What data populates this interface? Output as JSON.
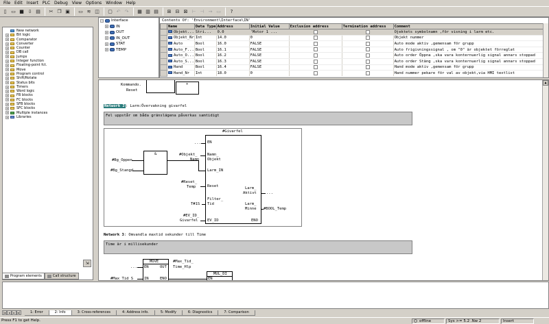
{
  "menu": [
    "File",
    "Edit",
    "Insert",
    "PLC",
    "Debug",
    "View",
    "Options",
    "Window",
    "Help"
  ],
  "catalog": {
    "items": [
      {
        "label": "New network",
        "expand": false,
        "kind": "new"
      },
      {
        "label": "Bit logic",
        "expand": true
      },
      {
        "label": "Comparator",
        "expand": true
      },
      {
        "label": "Converter",
        "expand": true
      },
      {
        "label": "Counter",
        "expand": true
      },
      {
        "label": "DB call",
        "expand": true
      },
      {
        "label": "Jumps",
        "expand": true
      },
      {
        "label": "Integer function",
        "expand": true
      },
      {
        "label": "Floating-point fct.",
        "expand": true
      },
      {
        "label": "Move",
        "expand": true
      },
      {
        "label": "Program control",
        "expand": true
      },
      {
        "label": "Shift/Rotate",
        "expand": true
      },
      {
        "label": "Status bits",
        "expand": true
      },
      {
        "label": "Timers",
        "expand": true
      },
      {
        "label": "Word logic",
        "expand": true
      },
      {
        "label": "FB blocks",
        "expand": true
      },
      {
        "label": "FC blocks",
        "expand": true
      },
      {
        "label": "SFB blocks",
        "expand": true
      },
      {
        "label": "SFC blocks",
        "expand": true
      },
      {
        "label": "Multiple instances",
        "expand": true,
        "kind": "multi"
      },
      {
        "label": "Libraries",
        "expand": true,
        "kind": "lib"
      }
    ],
    "tabs": [
      "Program elements",
      "Call structure"
    ]
  },
  "interface": {
    "root": "Interface",
    "items": [
      "IN",
      "OUT",
      "IN_OUT",
      "STAT",
      "TEMP"
    ]
  },
  "vartable": {
    "title": "Contents Of: 'Environment\\Interface\\IN'",
    "headers": [
      "Name",
      "Data Type",
      "Address",
      "Initial Value",
      "Exclusion address",
      "Termination address",
      "Comment"
    ],
    "rows": [
      {
        "name": "Objekt...",
        "type": "Stri...",
        "addr": "0.0",
        "init": "'Motor 1  ...",
        "comment": "Ojektets symbolnamn ,för visning i larm etc.",
        "sel": true
      },
      {
        "name": "Objekt_Nr",
        "type": "Int",
        "addr": "14.0",
        "init": "0",
        "comment": "Objekt nummer"
      },
      {
        "name": "Auto",
        "type": "Bool",
        "addr": "16.0",
        "init": "FALSE",
        "comment": "Auto mode aktiv ,gemensam för grupp"
      },
      {
        "name": "Auto_F...",
        "type": "Bool",
        "addr": "16.1",
        "init": "FALSE",
        "comment": "Auto frigivningssignal , om \"0\" är objektet förreglat"
      },
      {
        "name": "Auto_O...",
        "type": "Bool",
        "addr": "16.2",
        "init": "FALSE",
        "comment": "Auto order Öppna ,ska vara konternuerlig signal annars stoppad"
      },
      {
        "name": "Auto_S...",
        "type": "Bool",
        "addr": "16.3",
        "init": "FALSE",
        "comment": "Auto order Stäng ,ska vara konternuerlig signal annars stoppad"
      },
      {
        "name": "Hand",
        "type": "Bool",
        "addr": "16.4",
        "init": "FALSE",
        "comment": "Hand mode aktiv ,gemensam för grupp"
      },
      {
        "name": "Hand_Nr",
        "type": "Int",
        "addr": "18.0",
        "init": "0",
        "comment": "Hand nummer pekare för val av objekt,via HMI textlist"
      }
    ]
  },
  "editor": {
    "prev": {
      "line1": "Kommando.",
      "line2": "Reset",
      "plus": "+"
    },
    "net2": {
      "label": "Network 2",
      "title": ": Larm:Övervakning givarfel",
      "comment": "Fel uppstår om båda gränslägena påverkas samtidigt",
      "and_label": "&",
      "and_in1": "#Bg_Oppen",
      "and_in2": "#Bg_Stangd",
      "block": "#Givarfel",
      "en_in": "...",
      "p_en": "EN",
      "p_namn": "Namn_",
      "p_objekt": "Objekt",
      "p_larmin": "Larm_IN",
      "p_reset": "Reset",
      "p_filter1": "Filter_",
      "p_filter2": "Tid",
      "p_evid": "EV_ID",
      "p_aktivt1": "Larm_",
      "p_aktivt2": "Aktivt",
      "p_minne1": "Larm_",
      "p_minne2": "Minne",
      "p_eno": "ENO",
      "a_objekt1": "#Objekt_",
      "a_objekt2": "Namn",
      "a_reset1": "#Reset_",
      "a_reset2": "Temp",
      "a_tid": "T#1S",
      "a_evid1": "#EV_ID_",
      "a_evid2": "Givarfel",
      "a_aktivt": "...",
      "a_minne": "#BOOL_Temp"
    },
    "net3": {
      "label": "Network 3",
      "title": ": Omvandla maxtid sekunder till Time",
      "comment": "Time är i millisekunder",
      "move": "MOVE",
      "move_en": "EN",
      "move_out": "OUT",
      "move_in": "IN",
      "move_eno": "ENO",
      "en_in": "...",
      "in_val": "#Max Tid S",
      "out1": "#Max_Tid_",
      "out2": "Time_Hlp",
      "mul": "MUL_DI",
      "mul_en": "EN"
    }
  },
  "outtabs": [
    "1: Error",
    "2: Info",
    "3: Cross-references",
    "4: Address info.",
    "5: Modify",
    "6: Diagnostics",
    "7: Comparison"
  ],
  "status": {
    "left": "Press F1 to get Help.",
    "mode": "offline",
    "sys": "Sys >= 5.2 .Nw 2",
    "insert": "Insert"
  }
}
